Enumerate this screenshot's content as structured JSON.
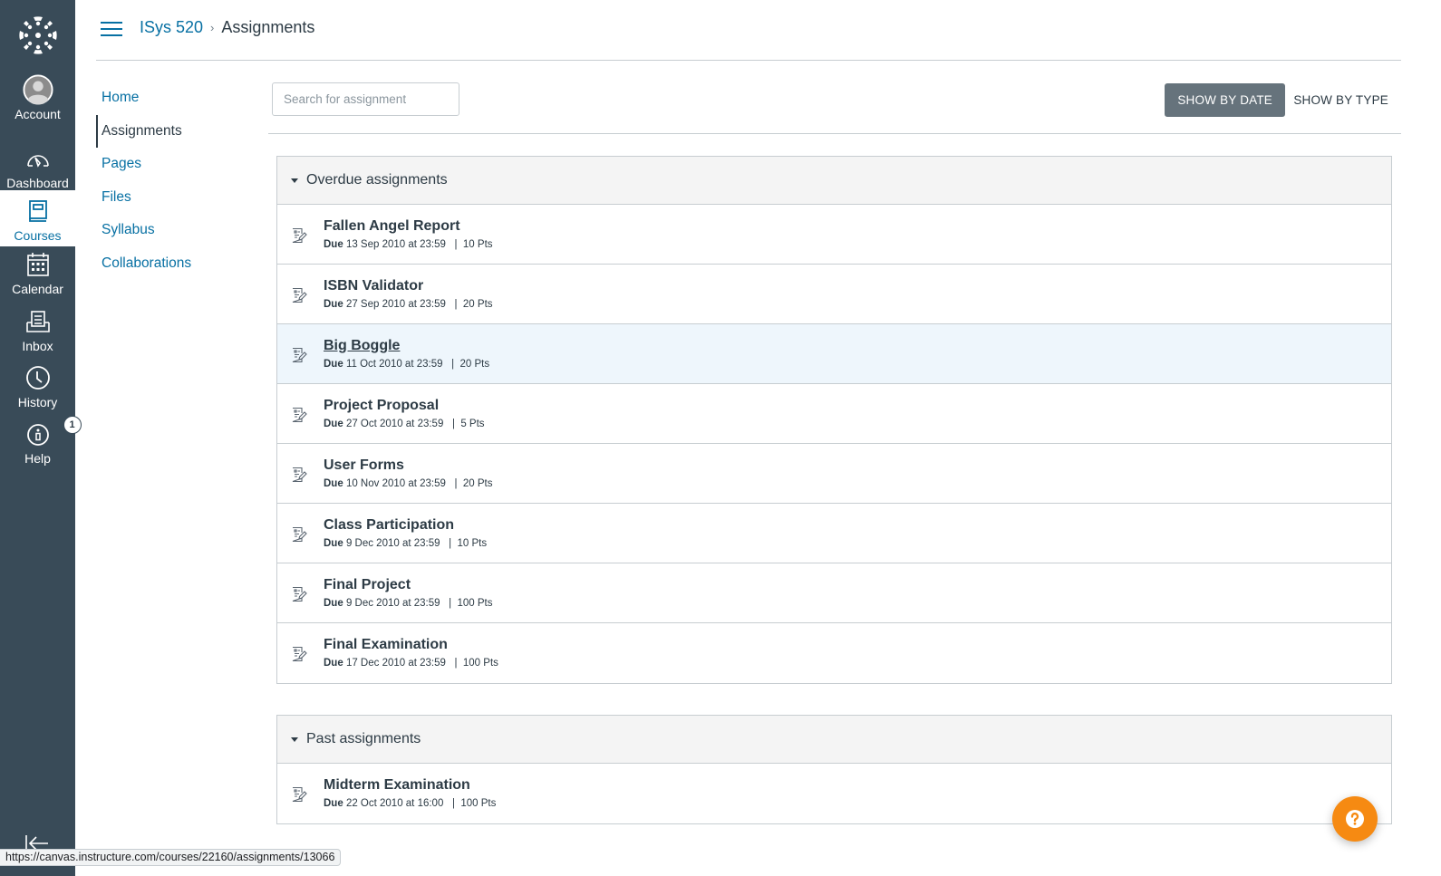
{
  "global_nav": {
    "items": [
      {
        "key": "account",
        "label": "Account",
        "icon": "avatar-icon"
      },
      {
        "key": "dashboard",
        "label": "Dashboard",
        "icon": "dashboard-icon"
      },
      {
        "key": "courses",
        "label": "Courses",
        "icon": "courses-icon",
        "active": true
      },
      {
        "key": "calendar",
        "label": "Calendar",
        "icon": "calendar-icon"
      },
      {
        "key": "inbox",
        "label": "Inbox",
        "icon": "inbox-icon"
      },
      {
        "key": "history",
        "label": "History",
        "icon": "history-icon"
      },
      {
        "key": "help",
        "label": "Help",
        "icon": "help-icon",
        "badge": "1"
      }
    ]
  },
  "header": {
    "breadcrumb": [
      {
        "label": "ISys 520",
        "link": true
      },
      {
        "label": "Assignments",
        "link": false
      }
    ],
    "separator": "›"
  },
  "course_nav": {
    "items": [
      {
        "label": "Home"
      },
      {
        "label": "Assignments",
        "active": true
      },
      {
        "label": "Pages"
      },
      {
        "label": "Files"
      },
      {
        "label": "Syllabus"
      },
      {
        "label": "Collaborations"
      }
    ]
  },
  "toolbar": {
    "search_placeholder": "Search for assignment",
    "search_value": "",
    "show_by_date": "SHOW BY DATE",
    "show_by_type": "SHOW BY TYPE",
    "active_view": "date"
  },
  "groups": [
    {
      "title": "Overdue assignments",
      "expanded": true,
      "assignments": [
        {
          "title": "Fallen Angel Report",
          "due_label": "Due",
          "due": "13 Sep 2010 at 23:59",
          "points": "10 Pts"
        },
        {
          "title": "ISBN Validator",
          "due_label": "Due",
          "due": "27 Sep 2010 at 23:59",
          "points": "20 Pts"
        },
        {
          "title": "Big Boggle",
          "due_label": "Due",
          "due": "11 Oct 2010 at 23:59",
          "points": "20 Pts",
          "hovered": true
        },
        {
          "title": "Project Proposal",
          "due_label": "Due",
          "due": "27 Oct 2010 at 23:59",
          "points": "5 Pts"
        },
        {
          "title": "User Forms",
          "due_label": "Due",
          "due": "10 Nov 2010 at 23:59",
          "points": "20 Pts"
        },
        {
          "title": "Class Participation",
          "due_label": "Due",
          "due": "9 Dec 2010 at 23:59",
          "points": "10 Pts"
        },
        {
          "title": "Final Project",
          "due_label": "Due",
          "due": "9 Dec 2010 at 23:59",
          "points": "100 Pts"
        },
        {
          "title": "Final Examination",
          "due_label": "Due",
          "due": "17 Dec 2010 at 23:59",
          "points": "100 Pts"
        }
      ]
    },
    {
      "title": "Past assignments",
      "expanded": true,
      "assignments": [
        {
          "title": "Midterm Examination",
          "due_label": "Due",
          "due": "22 Oct 2010 at 16:00",
          "points": "100 Pts"
        }
      ]
    }
  ],
  "status_bar": {
    "url": "https://canvas.instructure.com/courses/22160/assignments/13066"
  },
  "colors": {
    "nav_bg": "#394b58",
    "link": "#0770a3",
    "text": "#2d3b45",
    "active_button": "#66737c",
    "row_hover": "#eef6fc",
    "help_fab": "#f68a12"
  }
}
